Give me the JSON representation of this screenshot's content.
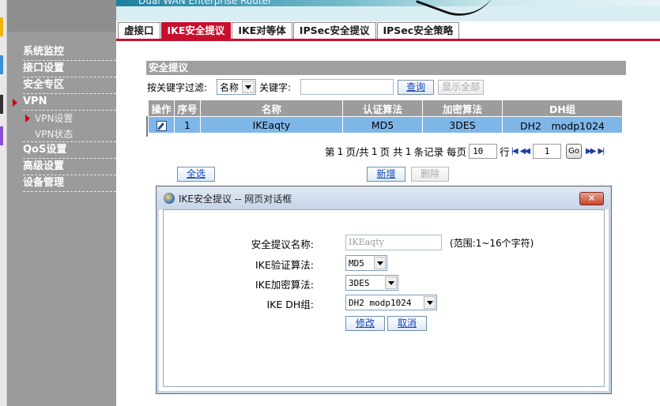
{
  "header": {
    "brand": "Dual WAN Enterprise Router"
  },
  "sidebar": {
    "items": [
      {
        "label": "系统监控"
      },
      {
        "label": "接口设置"
      },
      {
        "label": "安全专区"
      },
      {
        "label": "VPN"
      },
      {
        "label": "QoS设置"
      },
      {
        "label": "高级设置"
      },
      {
        "label": "设备管理"
      }
    ],
    "sub_items": [
      {
        "label": "VPN设置"
      },
      {
        "label": "VPN状态"
      }
    ]
  },
  "tabs": [
    {
      "label": "虚接口"
    },
    {
      "label": "IKE安全提议"
    },
    {
      "label": "IKE对等体"
    },
    {
      "label": "IPSec安全提议"
    },
    {
      "label": "IPSec安全策略"
    }
  ],
  "section": {
    "title": "安全提议",
    "filter_label": "按关键字过滤:",
    "filter_select": "名称",
    "keyword_label": "关键字:",
    "keyword_value": "",
    "search_button": "查询",
    "show_all_button": "显示全部"
  },
  "table": {
    "columns": [
      "操作",
      "序号",
      "名称",
      "认证算法",
      "加密算法",
      "DH组"
    ],
    "rows": [
      {
        "index": "1",
        "name": "IKEaqty",
        "auth": "MD5",
        "encrypt": "3DES",
        "dh": "DH2　modp1024"
      }
    ]
  },
  "pager": {
    "text_page": "第",
    "current_page": "1",
    "text_total": "页/共",
    "total_pages": "1",
    "text_pages": "页 共",
    "record_count": "1",
    "text_records": "条记录 每页",
    "per_page": "10",
    "text_rows": "行",
    "jump_page": "1",
    "go_label": "Go"
  },
  "actions": {
    "select_all": "全选",
    "add": "新增",
    "delete": "删除"
  },
  "dialog": {
    "title": "IKE安全提议 -- 网页对话框",
    "close_label": "✕",
    "fields": {
      "name_label": "安全提议名称:",
      "name_value": "IKEaqty",
      "name_hint": "(范围:1~16个字符)",
      "auth_label": "IKE验证算法:",
      "auth_value": "MD5",
      "encrypt_label": "IKE加密算法:",
      "encrypt_value": "3DES",
      "dh_label": "IKE DH组:",
      "dh_value": "DH2 modp1024"
    },
    "modify_button": "修改",
    "cancel_button": "取消"
  },
  "colors": {
    "accent_red": "#c8102e",
    "sidebar_gray": "#9b9b9b",
    "row_highlight": "#7fb6e8",
    "header_gray": "#9c9c9c"
  }
}
